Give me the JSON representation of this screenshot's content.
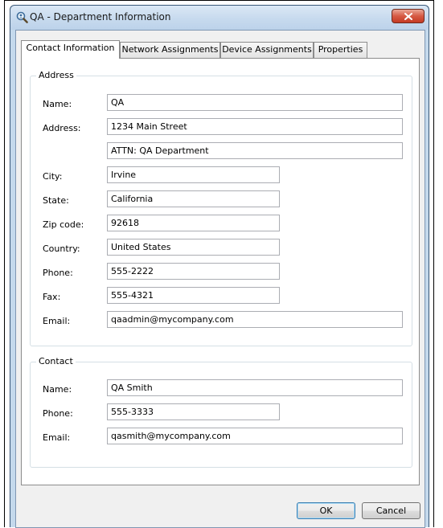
{
  "window": {
    "title": "QA - Department Information",
    "icons": {
      "app": "magnifier-icon",
      "close": "close-icon"
    }
  },
  "tabs": [
    {
      "label": "Contact Information",
      "active": true
    },
    {
      "label": "Network Assignments",
      "active": false
    },
    {
      "label": "Device Assignments",
      "active": false
    },
    {
      "label": "Properties",
      "active": false
    }
  ],
  "address": {
    "title": "Address",
    "name_label": "Name:",
    "name": "QA",
    "address_label": "Address:",
    "address1": "1234 Main Street",
    "address2": "ATTN: QA Department",
    "city_label": "City:",
    "city": "Irvine",
    "state_label": "State:",
    "state": "California",
    "zip_label": "Zip code:",
    "zip": "92618",
    "country_label": "Country:",
    "country": "United States",
    "phone_label": "Phone:",
    "phone": "555-2222",
    "fax_label": "Fax:",
    "fax": "555-4321",
    "email_label": "Email:",
    "email": "qaadmin@mycompany.com"
  },
  "contact": {
    "title": "Contact",
    "name_label": "Name:",
    "name": "QA Smith",
    "phone_label": "Phone:",
    "phone": "555-3333",
    "email_label": "Email:",
    "email": "qasmith@mycompany.com"
  },
  "buttons": {
    "ok": "OK",
    "cancel": "Cancel"
  },
  "colors": {
    "window_frame": "#c4d9ec",
    "close_button": "#c53a24",
    "face": "#f0f0f0"
  }
}
